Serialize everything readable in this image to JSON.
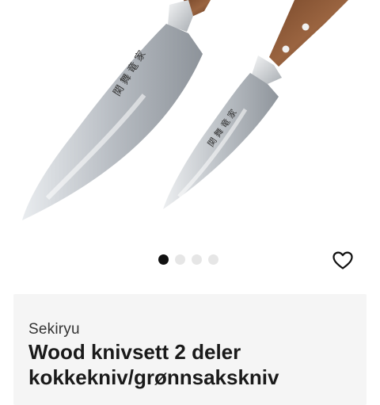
{
  "product": {
    "brand": "Sekiryu",
    "title_line1": "Wood knivsett 2 deler",
    "title_line2": "kokkekniv/grønnsakskniv"
  },
  "gallery": {
    "image_count": 4,
    "active_index": 0
  },
  "icons": {
    "favorite": "heart-outline-icon"
  },
  "colors": {
    "active_dot": "#111111",
    "inactive_dot": "#e6e6e6",
    "card_background": "#f5f5f5"
  }
}
